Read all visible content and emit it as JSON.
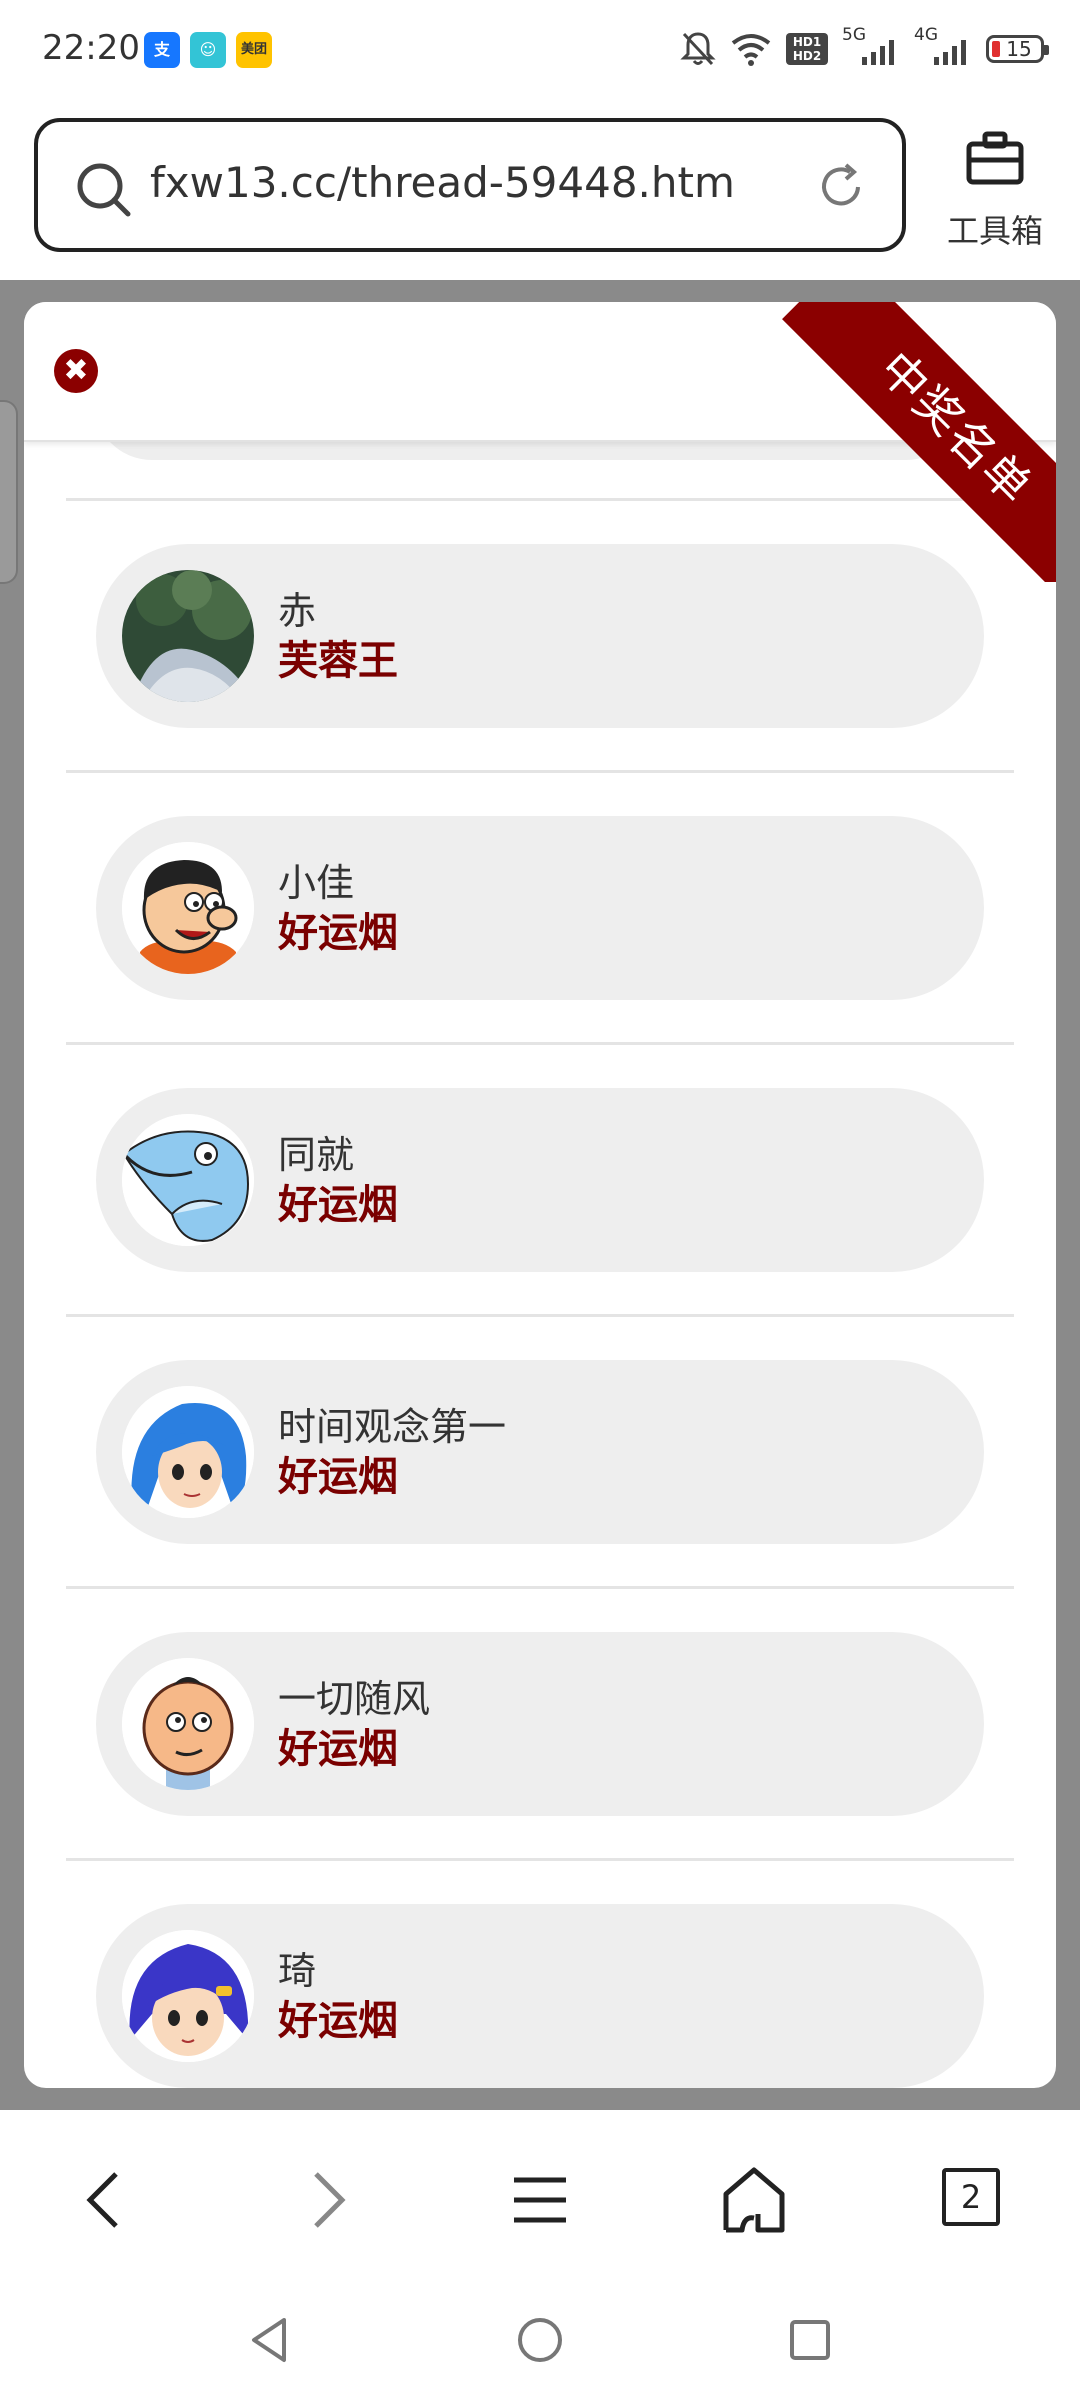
{
  "status_bar": {
    "time": "22:20",
    "apps": [
      {
        "icon": "alipay-icon",
        "label": "支",
        "color": "#1677ff"
      },
      {
        "icon": "chat-app-icon",
        "label": "☺",
        "color": "#33c4d6"
      },
      {
        "icon": "meituan-icon",
        "label": "美团",
        "color": "#ffc300"
      }
    ],
    "hd_badge": "HD1 HD2",
    "network_1": "5G",
    "network_2": "4G",
    "battery": "15"
  },
  "browser": {
    "url": "fxw13.cc/thread-59448.htm",
    "toolbox_label": "工具箱",
    "tab_count": "2"
  },
  "modal": {
    "ribbon_label": "中奖名单",
    "winners": [
      {
        "name": "赤",
        "prize": "芙蓉王",
        "avatar": "photo-avatar"
      },
      {
        "name": "小佳",
        "prize": "好运烟",
        "avatar": "cartoon-man-avatar"
      },
      {
        "name": "同就",
        "prize": "好运烟",
        "avatar": "dolphin-avatar"
      },
      {
        "name": "时间观念第一",
        "prize": "好运烟",
        "avatar": "blue-hair-girl-avatar"
      },
      {
        "name": "一切随风",
        "prize": "好运烟",
        "avatar": "bald-boy-avatar"
      },
      {
        "name": "琦",
        "prize": "好运烟",
        "avatar": "purple-hair-girl-avatar"
      }
    ]
  },
  "colors": {
    "accent": "#8b0000",
    "prize_text": "#7a0000",
    "pill_bg": "#eeeeee",
    "overlay": "#8a8a8a"
  }
}
